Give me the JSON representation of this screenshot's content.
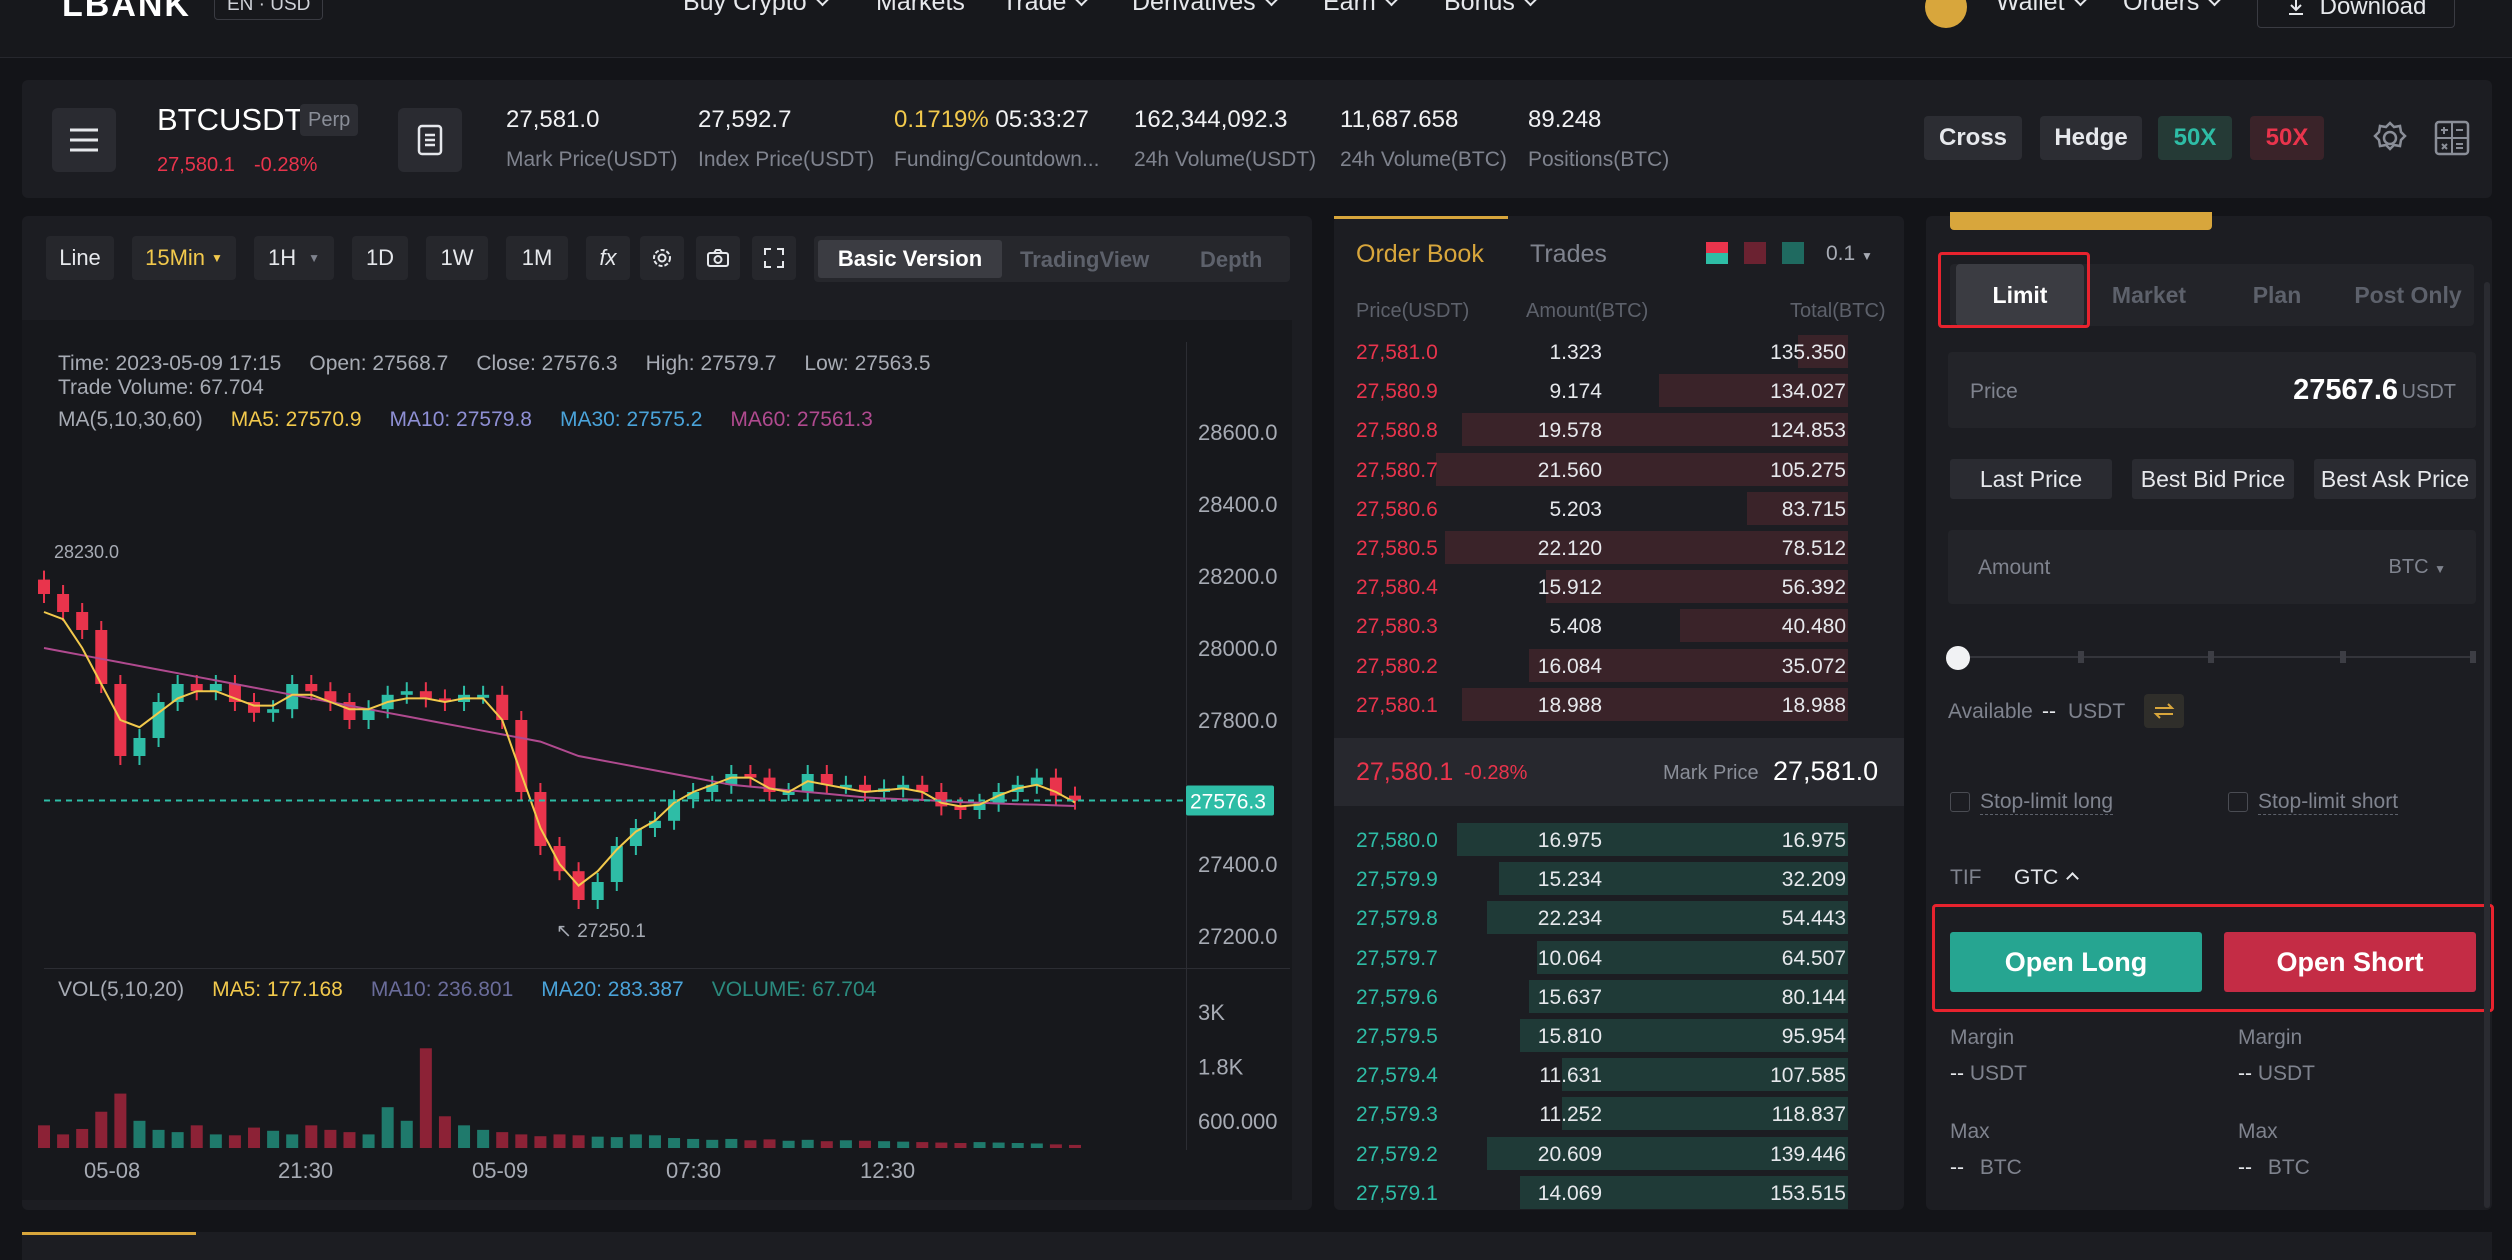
{
  "nav": {
    "logo": "LBANK",
    "lang": "EN · USD",
    "items": [
      "Buy Crypto",
      "Markets",
      "Trade",
      "Derivatives",
      "Earn",
      "Bonus"
    ],
    "wallet": "Wallet",
    "orders": "Orders",
    "download": "Download"
  },
  "ticker": {
    "symbol": "BTCUSDT",
    "tag": "Perp",
    "last": "27,580.1",
    "change": "-0.28%",
    "stats": [
      {
        "value": "27,581.0",
        "label": "Mark Price(USDT)"
      },
      {
        "value": "27,592.7",
        "label": "Index Price(USDT)"
      },
      {
        "value": "0.1719%",
        "value2": "05:33:27",
        "label": "Funding/Countdown..."
      },
      {
        "value": "162,344,092.3",
        "label": "24h Volume(USDT)"
      },
      {
        "value": "11,687.658",
        "label": "24h Volume(BTC)"
      },
      {
        "value": "89.248",
        "label": "Positions(BTC)"
      }
    ],
    "cross": "Cross",
    "hedge": "Hedge",
    "lev_long": "50X",
    "lev_short": "50X"
  },
  "chart_toolbar": {
    "line": "Line",
    "min15": "15Min",
    "h1": "1H",
    "d1": "1D",
    "w1": "1W",
    "m1": "1M",
    "fx": "fx",
    "basic": "Basic Version",
    "tv": "TradingView",
    "depth": "Depth"
  },
  "chart_info": {
    "time": "Time: 2023-05-09 17:15",
    "open": "Open: 27568.7",
    "close": "Close: 27576.3",
    "high": "High: 27579.7",
    "low": "Low: 27563.5",
    "volume": "Trade Volume: 67.704",
    "ma_title": "MA(5,10,30,60)",
    "ma5": "MA5: 27570.9",
    "ma10": "MA10: 27579.8",
    "ma30": "MA30: 27575.2",
    "ma60": "MA60: 27561.3",
    "vol_title": "VOL(5,10,20)",
    "vma5": "MA5: 177.168",
    "vma10": "MA10: 236.801",
    "vma20": "MA20: 283.387",
    "vvol": "VOLUME: 67.704",
    "hi_mark": "28230.0",
    "lo_mark": "27250.1",
    "current": "27576.3"
  },
  "chart_data": {
    "type": "line",
    "title": "",
    "y_ticks": [
      "28600.0",
      "28400.0",
      "28200.0",
      "28000.0",
      "27800.0",
      "27400.0",
      "27200.0"
    ],
    "y_ticks_values": [
      28600,
      28400,
      28200,
      28000,
      27800,
      27400,
      27200
    ],
    "x_ticks": [
      "05-08",
      "21:30",
      "05-09",
      "07:30",
      "12:30"
    ],
    "vol_ticks": [
      "3K",
      "1.8K",
      "600.000"
    ],
    "ylim": [
      27150,
      28700
    ],
    "price_close": [
      28150,
      28100,
      28050,
      27900,
      27700,
      27750,
      27850,
      27900,
      27880,
      27900,
      27850,
      27820,
      27830,
      27900,
      27880,
      27850,
      27800,
      27830,
      27870,
      27880,
      27860,
      27850,
      27870,
      27870,
      27800,
      27600,
      27450,
      27380,
      27300,
      27350,
      27450,
      27500,
      27520,
      27580,
      27600,
      27620,
      27650,
      27640,
      27600,
      27600,
      27650,
      27620,
      27620,
      27600,
      27610,
      27620,
      27600,
      27560,
      27550,
      27570,
      27600,
      27620,
      27640,
      27590,
      27576
    ],
    "ma5": [
      28100,
      28080,
      28000,
      27900,
      27800,
      27780,
      27820,
      27860,
      27880,
      27880,
      27860,
      27840,
      27840,
      27870,
      27870,
      27850,
      27830,
      27830,
      27850,
      27860,
      27860,
      27850,
      27860,
      27860,
      27800,
      27650,
      27500,
      27400,
      27340,
      27380,
      27440,
      27490,
      27520,
      27570,
      27600,
      27620,
      27640,
      27640,
      27610,
      27600,
      27630,
      27620,
      27610,
      27600,
      27605,
      27610,
      27600,
      27570,
      27560,
      27565,
      27590,
      27610,
      27620,
      27600,
      27571
    ],
    "ma60": [
      28000,
      27990,
      27980,
      27970,
      27960,
      27950,
      27940,
      27930,
      27920,
      27910,
      27900,
      27890,
      27880,
      27870,
      27860,
      27850,
      27840,
      27830,
      27820,
      27810,
      27800,
      27790,
      27780,
      27770,
      27760,
      27750,
      27740,
      27720,
      27700,
      27690,
      27680,
      27670,
      27660,
      27650,
      27640,
      27630,
      27620,
      27615,
      27610,
      27605,
      27600,
      27595,
      27590,
      27585,
      27582,
      27580,
      27578,
      27575,
      27572,
      27570,
      27568,
      27566,
      27565,
      27563,
      27561
    ],
    "volume": [
      500,
      300,
      420,
      800,
      1200,
      600,
      400,
      350,
      500,
      300,
      280,
      450,
      380,
      300,
      500,
      400,
      350,
      300,
      900,
      600,
      2200,
      700,
      500,
      400,
      350,
      300,
      260,
      300,
      280,
      250,
      240,
      300,
      280,
      220,
      200,
      180,
      200,
      170,
      190,
      160,
      180,
      150,
      170,
      160,
      150,
      140,
      130,
      120,
      110,
      130,
      120,
      110,
      100,
      80,
      68
    ]
  },
  "orderbook": {
    "tab_book": "Order Book",
    "tab_trades": "Trades",
    "precision": "0.1",
    "headers": [
      "Price(USDT)",
      "Amount(BTC)",
      "Total(BTC)"
    ],
    "asks": [
      [
        "27,581.0",
        "1.323",
        "135.350"
      ],
      [
        "27,580.9",
        "9.174",
        "134.027"
      ],
      [
        "27,580.8",
        "19.578",
        "124.853"
      ],
      [
        "27,580.7",
        "21.560",
        "105.275"
      ],
      [
        "27,580.6",
        "5.203",
        "83.715"
      ],
      [
        "27,580.5",
        "22.120",
        "78.512"
      ],
      [
        "27,580.4",
        "15.912",
        "56.392"
      ],
      [
        "27,580.3",
        "5.408",
        "40.480"
      ],
      [
        "27,580.2",
        "16.084",
        "35.072"
      ],
      [
        "27,580.1",
        "18.988",
        "18.988"
      ]
    ],
    "ask_depth": [
      0.12,
      0.45,
      0.92,
      0.98,
      0.24,
      0.96,
      0.72,
      0.4,
      0.76,
      0.92
    ],
    "mid_price": "27,580.1",
    "mid_change": "-0.28%",
    "mark_label": "Mark Price",
    "mark_price": "27,581.0",
    "bids": [
      [
        "27,580.0",
        "16.975",
        "16.975"
      ],
      [
        "27,579.9",
        "15.234",
        "32.209"
      ],
      [
        "27,579.8",
        "22.234",
        "54.443"
      ],
      [
        "27,579.7",
        "10.064",
        "64.507"
      ],
      [
        "27,579.6",
        "15.637",
        "80.144"
      ],
      [
        "27,579.5",
        "15.810",
        "95.954"
      ],
      [
        "27,579.4",
        "11.631",
        "107.585"
      ],
      [
        "27,579.3",
        "11.252",
        "118.837"
      ],
      [
        "27,579.2",
        "20.609",
        "139.446"
      ],
      [
        "27,579.1",
        "14.069",
        "153.515"
      ]
    ],
    "bid_depth": [
      0.93,
      0.83,
      0.86,
      0.74,
      0.76,
      0.78,
      0.68,
      0.68,
      0.86,
      0.78
    ]
  },
  "order_form": {
    "tabs": [
      "Limit",
      "Market",
      "Plan",
      "Post Only"
    ],
    "price_label": "Price",
    "price_value": "27567.6",
    "price_unit": "USDT",
    "quick": [
      "Last Price",
      "Best Bid Price",
      "Best Ask Price"
    ],
    "amount_label": "Amount",
    "amount_unit": "BTC",
    "available_label": "Available",
    "available_value": "--",
    "available_unit": "USDT",
    "stop_long": "Stop-limit long",
    "stop_short": "Stop-limit short",
    "tif_label": "TIF",
    "tif_value": "GTC",
    "open_long": "Open Long",
    "open_short": "Open Short",
    "margin_label": "Margin",
    "margin_value": "--",
    "margin_unit": "USDT",
    "max_label": "Max",
    "max_value": "--",
    "max_unit": "BTC"
  },
  "colors": {
    "green": "#2ebda6",
    "red": "#e9344c",
    "ma5": "#f2c94c",
    "ma10": "#8e8fd4",
    "ma30": "#4aa3d9",
    "ma60": "#b04a8f"
  }
}
